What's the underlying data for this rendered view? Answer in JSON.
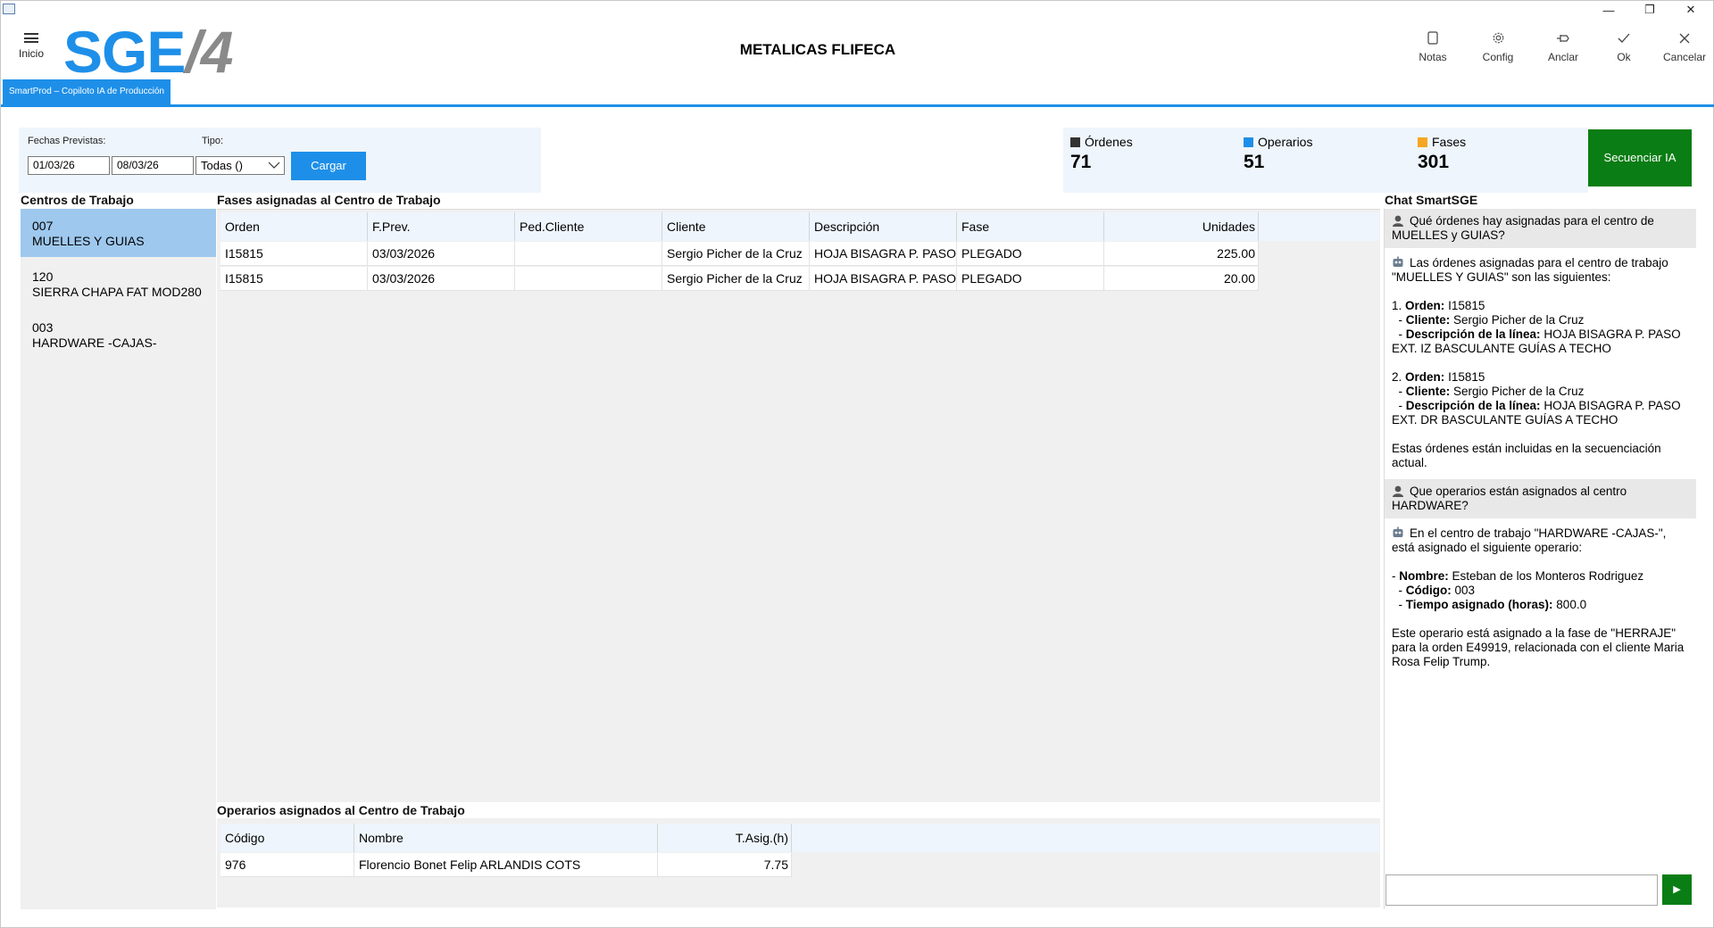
{
  "window": {
    "minimize": "—",
    "restore": "❐",
    "close": "✕"
  },
  "header": {
    "home_label": "Inicio",
    "logo_main": "SGE",
    "logo_suffix": "/4",
    "company": "METALICAS FLIFECA",
    "toolbar": [
      {
        "label": "Notas",
        "icon": "notes-icon"
      },
      {
        "label": "Config",
        "icon": "gear-icon"
      },
      {
        "label": "Anclar",
        "icon": "pin-icon"
      },
      {
        "label": "Ok",
        "icon": "check-icon"
      },
      {
        "label": "Cancelar",
        "icon": "close-icon"
      }
    ]
  },
  "tab": {
    "label": "SmartProd – Copiloto IA de Producción"
  },
  "filters": {
    "dates_label": "Fechas Previstas:",
    "date_from": "01/03/26",
    "date_to": "08/03/26",
    "type_label": "Tipo:",
    "type_value": "Todas ()",
    "load_button": "Cargar"
  },
  "stats": {
    "orders": {
      "label": "Órdenes",
      "value": "71",
      "color": "#333333"
    },
    "operators": {
      "label": "Operarios",
      "value": "51",
      "color": "#1e8fe8"
    },
    "phases": {
      "label": "Fases",
      "value": "301",
      "color": "#f5a623"
    },
    "sequence_button": "Secuenciar IA"
  },
  "centers": {
    "title": "Centros de Trabajo",
    "items": [
      {
        "code": "007",
        "name": "MUELLES Y GUIAS",
        "selected": true
      },
      {
        "code": "120",
        "name": "SIERRA CHAPA FAT MOD280",
        "selected": false
      },
      {
        "code": "003",
        "name": "HARDWARE -CAJAS-",
        "selected": false
      }
    ]
  },
  "phases": {
    "title": "Fases asignadas al Centro de Trabajo",
    "columns": [
      "Orden",
      "F.Prev.",
      "Ped.Cliente",
      "Cliente",
      "Descripción",
      "Fase",
      "Unidades"
    ],
    "rows": [
      [
        "I15815",
        "03/03/2026",
        "",
        "Sergio Picher de la Cruz",
        "HOJA BISAGRA P. PASO",
        "PLEGADO",
        "225.00"
      ],
      [
        "I15815",
        "03/03/2026",
        "",
        "Sergio Picher de la Cruz",
        "HOJA BISAGRA P. PASO",
        "PLEGADO",
        "20.00"
      ]
    ]
  },
  "operators": {
    "title": "Operarios asignados al Centro de Trabajo",
    "columns": [
      "Código",
      "Nombre",
      "T.Asig.(h)"
    ],
    "rows": [
      [
        "976",
        "Florencio Bonet Felip ARLANDIS COTS",
        "7.75"
      ]
    ]
  },
  "chat": {
    "title": "Chat SmartSGE",
    "q1": "Qué órdenes hay asignadas para el centro de MUELLES y GUIAS?",
    "a1_intro": "Las órdenes asignadas para el centro de trabajo \"MUELLES Y GUIAS\" son las siguientes:",
    "a1_o1_num": "1.",
    "k_orden": "Orden:",
    "k_cliente": "Cliente:",
    "k_desc": "Descripción de la línea:",
    "a1_o1_orden": "I15815",
    "a1_o1_cliente": "Sergio Picher de la Cruz",
    "a1_o1_desc": "HOJA BISAGRA P. PASO EXT. IZ BASCULANTE GUÍAS A TECHO",
    "a1_o2_num": "2.",
    "a1_o2_orden": "I15815",
    "a1_o2_cliente": "Sergio Picher de la Cruz",
    "a1_o2_desc": "HOJA BISAGRA P. PASO EXT. DR BASCULANTE GUÍAS A TECHO",
    "a1_outro": "Estas órdenes están incluidas en la secuenciación actual.",
    "q2": "Que operarios están asignados al centro HARDWARE?",
    "a2_intro": "En el centro de trabajo \"HARDWARE -CAJAS-\", está asignado el siguiente operario:",
    "k_nombre": "Nombre:",
    "k_codigo": "Código:",
    "k_tiempo": "Tiempo asignado (horas):",
    "a2_nombre": "Esteban de los Monteros Rodriguez",
    "a2_codigo": "003",
    "a2_tiempo": "800.0",
    "a2_outro": "Este operario está asignado a la fase de \"HERRAJE\" para la orden E49919, relacionada con el cliente Maria Rosa Felip Trump.",
    "input_value": "",
    "send_icon": "▶"
  }
}
